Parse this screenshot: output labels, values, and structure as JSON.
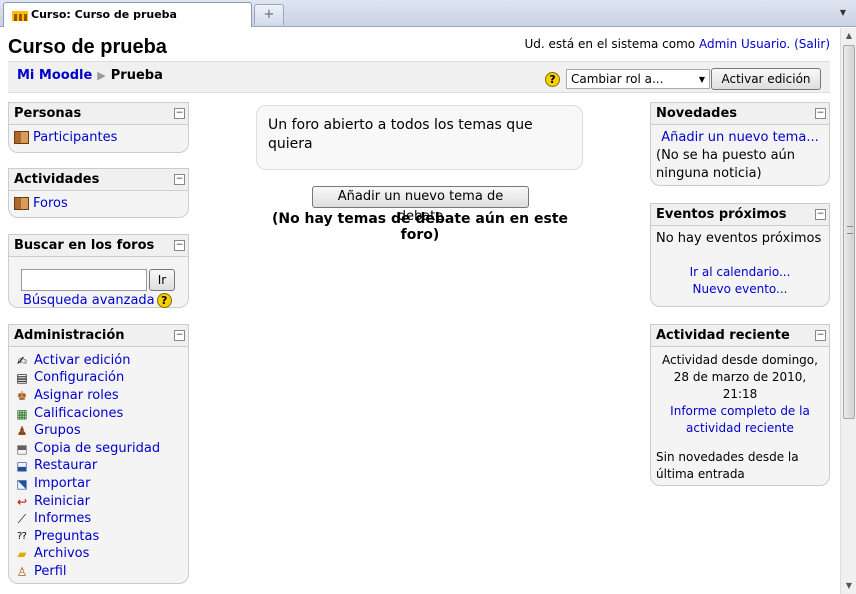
{
  "browser": {
    "tab_title": "Curso: Curso de prueba",
    "new_tab_symbol": "+",
    "tab_menu_symbol": "▼"
  },
  "header": {
    "course_title": "Curso de prueba",
    "login_prefix": "Ud. está en el sistema como",
    "user_name": "Admin Usuario.",
    "logout_label": "(Salir)"
  },
  "navbar": {
    "breadcrumb": [
      "Mi Moodle",
      "Prueba"
    ],
    "separator": "▶",
    "role_select": "Cambiar rol a...",
    "edit_button": "Activar edición"
  },
  "left": {
    "personas": {
      "title": "Personas",
      "items": [
        "Participantes"
      ]
    },
    "actividades": {
      "title": "Actividades",
      "items": [
        "Foros"
      ]
    },
    "buscar": {
      "title": "Buscar en los foros",
      "go_label": "Ir",
      "advanced": "Búsqueda avanzada"
    },
    "administracion": {
      "title": "Administración",
      "items": [
        {
          "label": "Activar edición",
          "icon": "edit-icon"
        },
        {
          "label": "Configuración",
          "icon": "settings-icon"
        },
        {
          "label": "Asignar roles",
          "icon": "roles-icon"
        },
        {
          "label": "Calificaciones",
          "icon": "grades-icon"
        },
        {
          "label": "Grupos",
          "icon": "groups-icon"
        },
        {
          "label": "Copia de seguridad",
          "icon": "backup-icon"
        },
        {
          "label": "Restaurar",
          "icon": "restore-icon"
        },
        {
          "label": "Importar",
          "icon": "import-icon"
        },
        {
          "label": "Reiniciar",
          "icon": "reset-icon"
        },
        {
          "label": "Informes",
          "icon": "reports-icon"
        },
        {
          "label": "Preguntas",
          "icon": "questions-icon"
        },
        {
          "label": "Archivos",
          "icon": "folder-icon"
        },
        {
          "label": "Perfil",
          "icon": "profile-icon"
        }
      ]
    }
  },
  "center": {
    "forum_intro": "Un foro abierto a todos los temas que quiera",
    "new_topic_button": "Añadir un nuevo tema de debate",
    "no_topics": "(No hay temas de debate aún en este foro)"
  },
  "right": {
    "novedades": {
      "title": "Novedades",
      "add_link": "Añadir un nuevo tema...",
      "empty": "(No se ha puesto aún ninguna noticia)"
    },
    "eventos": {
      "title": "Eventos próximos",
      "empty": "No hay eventos próximos",
      "calendar_link": "Ir al calendario...",
      "new_event_link": "Nuevo evento..."
    },
    "actividad": {
      "title": "Actividad reciente",
      "since": "Actividad desde domingo, 28 de marzo de 2010, 21:18",
      "report_link": "Informe completo de la actividad reciente",
      "no_news": "Sin novedades desde la última entrada"
    }
  },
  "colors": {
    "link": "#0000cc",
    "block_bg": "#f4f4f4",
    "help_icon": "#f5d000"
  }
}
